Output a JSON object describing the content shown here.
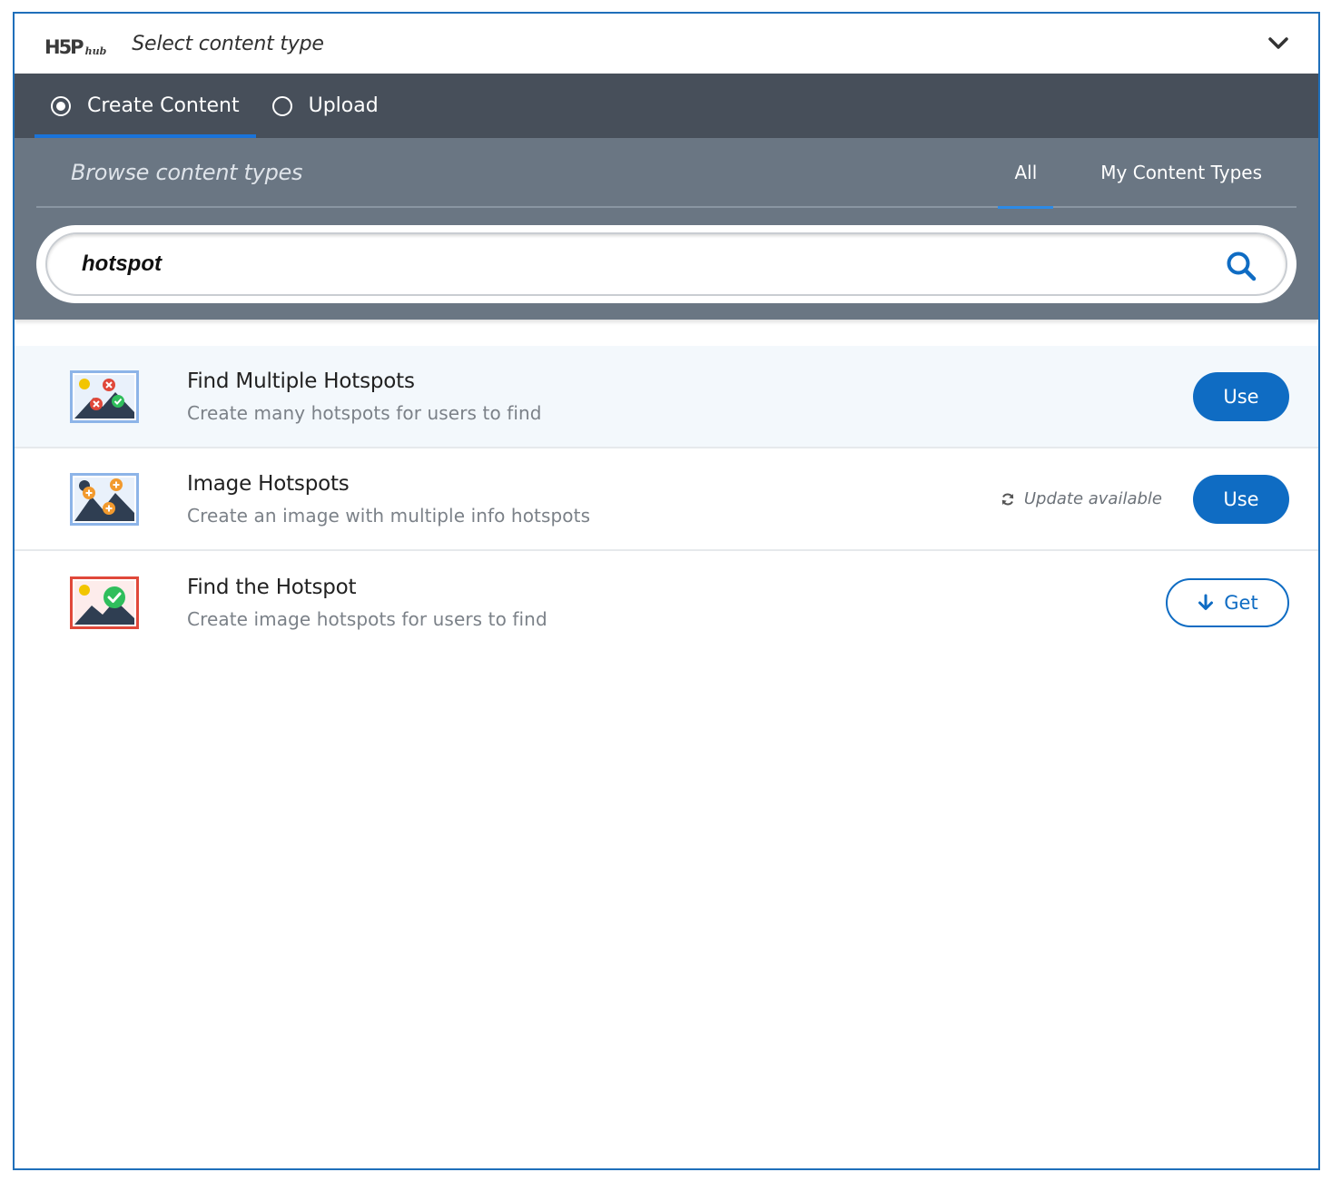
{
  "header": {
    "logo_main": "H5P",
    "logo_sub": "hub",
    "title": "Select content type"
  },
  "panel_tabs": [
    {
      "label": "Create Content",
      "selected": true
    },
    {
      "label": "Upload",
      "selected": false
    }
  ],
  "browse": {
    "title": "Browse content types",
    "filters": [
      {
        "label": "All",
        "active": true
      },
      {
        "label": "My Content Types",
        "active": false
      }
    ]
  },
  "search": {
    "value": "hotspot"
  },
  "results": [
    {
      "title": "Find Multiple Hotspots",
      "summary": "Create many hotspots for users to find",
      "action": "Use",
      "icon": "find-multiple-hotspots-icon"
    },
    {
      "title": "Image Hotspots",
      "summary": "Create an image with multiple info hotspots",
      "update_label": "Update available",
      "action": "Use",
      "icon": "image-hotspots-icon"
    },
    {
      "title": "Find the Hotspot",
      "summary": "Create image hotspots for users to find",
      "action": "Get",
      "icon": "find-the-hotspot-icon"
    }
  ],
  "colors": {
    "frame_border": "#1f6fba",
    "tab_bar": "#474f5a",
    "browse_panel": "#6a7683",
    "primary": "#0f6cc3",
    "tab_underline": "#1a73d9"
  }
}
